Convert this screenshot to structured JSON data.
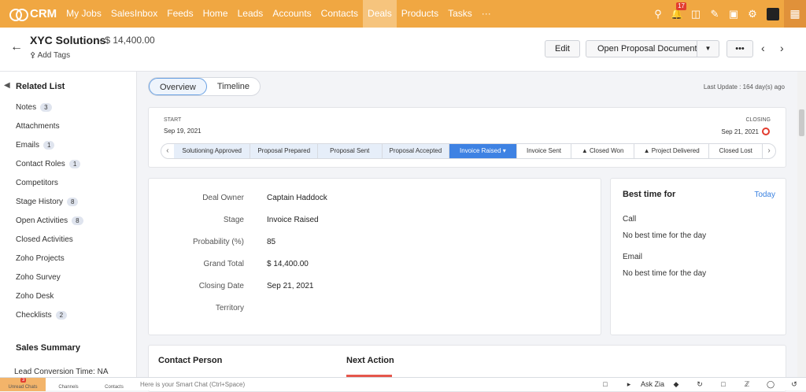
{
  "nav": {
    "app_name": "CRM",
    "items": [
      "My Jobs",
      "SalesInbox",
      "Feeds",
      "Home",
      "Leads",
      "Accounts",
      "Contacts",
      "Deals",
      "Products",
      "Tasks",
      "···"
    ],
    "notification_count": "17"
  },
  "header": {
    "title": "XYC Solutions",
    "amount": "- $ 14,400.00",
    "add_tags": "Add Tags",
    "edit_label": "Edit",
    "open_proposal_label": "Open Proposal Document",
    "more_label": "•••"
  },
  "sidebar": {
    "heading": "Related List",
    "items": [
      {
        "label": "Notes",
        "count": "3"
      },
      {
        "label": "Attachments",
        "count": ""
      },
      {
        "label": "Emails",
        "count": "1"
      },
      {
        "label": "Contact Roles",
        "count": "1"
      },
      {
        "label": "Competitors",
        "count": ""
      },
      {
        "label": "Stage History",
        "count": "8"
      },
      {
        "label": "Open Activities",
        "count": "8"
      },
      {
        "label": "Closed Activities",
        "count": ""
      },
      {
        "label": "Zoho Projects",
        "count": ""
      },
      {
        "label": "Zoho Survey",
        "count": ""
      },
      {
        "label": "Zoho Desk",
        "count": ""
      },
      {
        "label": "Checklists",
        "count": "2"
      }
    ],
    "summary_heading": "Sales Summary",
    "summary_line": "Lead Conversion Time: NA"
  },
  "tabs": [
    "Overview",
    "Timeline"
  ],
  "last_update": "Last Update : 164 day(s) ago",
  "stage_bar": {
    "start_label": "START",
    "start_date": "Sep 19, 2021",
    "closing_label": "CLOSING",
    "closing_date": "Sep 21, 2021",
    "stages": [
      "Solutioning Approved",
      "Proposal Prepared",
      "Proposal Sent",
      "Proposal Accepted",
      "Invoice Raised ▾",
      "Invoice Sent",
      "Closed Won",
      "Project Delivered",
      "Closed Lost"
    ]
  },
  "details": [
    {
      "label": "Deal Owner",
      "value": "Captain Haddock"
    },
    {
      "label": "Stage",
      "value": "Invoice Raised"
    },
    {
      "label": "Probability (%)",
      "value": "85"
    },
    {
      "label": "Grand Total",
      "value": "$ 14,400.00"
    },
    {
      "label": "Closing Date",
      "value": "Sep 21, 2021"
    },
    {
      "label": "Territory",
      "value": ""
    }
  ],
  "best_time": {
    "title": "Best time for",
    "today": "Today",
    "call_label": "Call",
    "call_text": "No best time for the day",
    "email_label": "Email",
    "email_text": "No best time for the day"
  },
  "bottom": {
    "contact_person": "Contact Person",
    "next_action": "Next Action"
  },
  "footer": {
    "unread_chats": "Unread Chats",
    "unread_count": "3",
    "channels": "Channels",
    "contacts": "Contacts",
    "chat_placeholder": "Here is your Smart Chat (Ctrl+Space)",
    "ask_zia": "Ask Zia"
  }
}
